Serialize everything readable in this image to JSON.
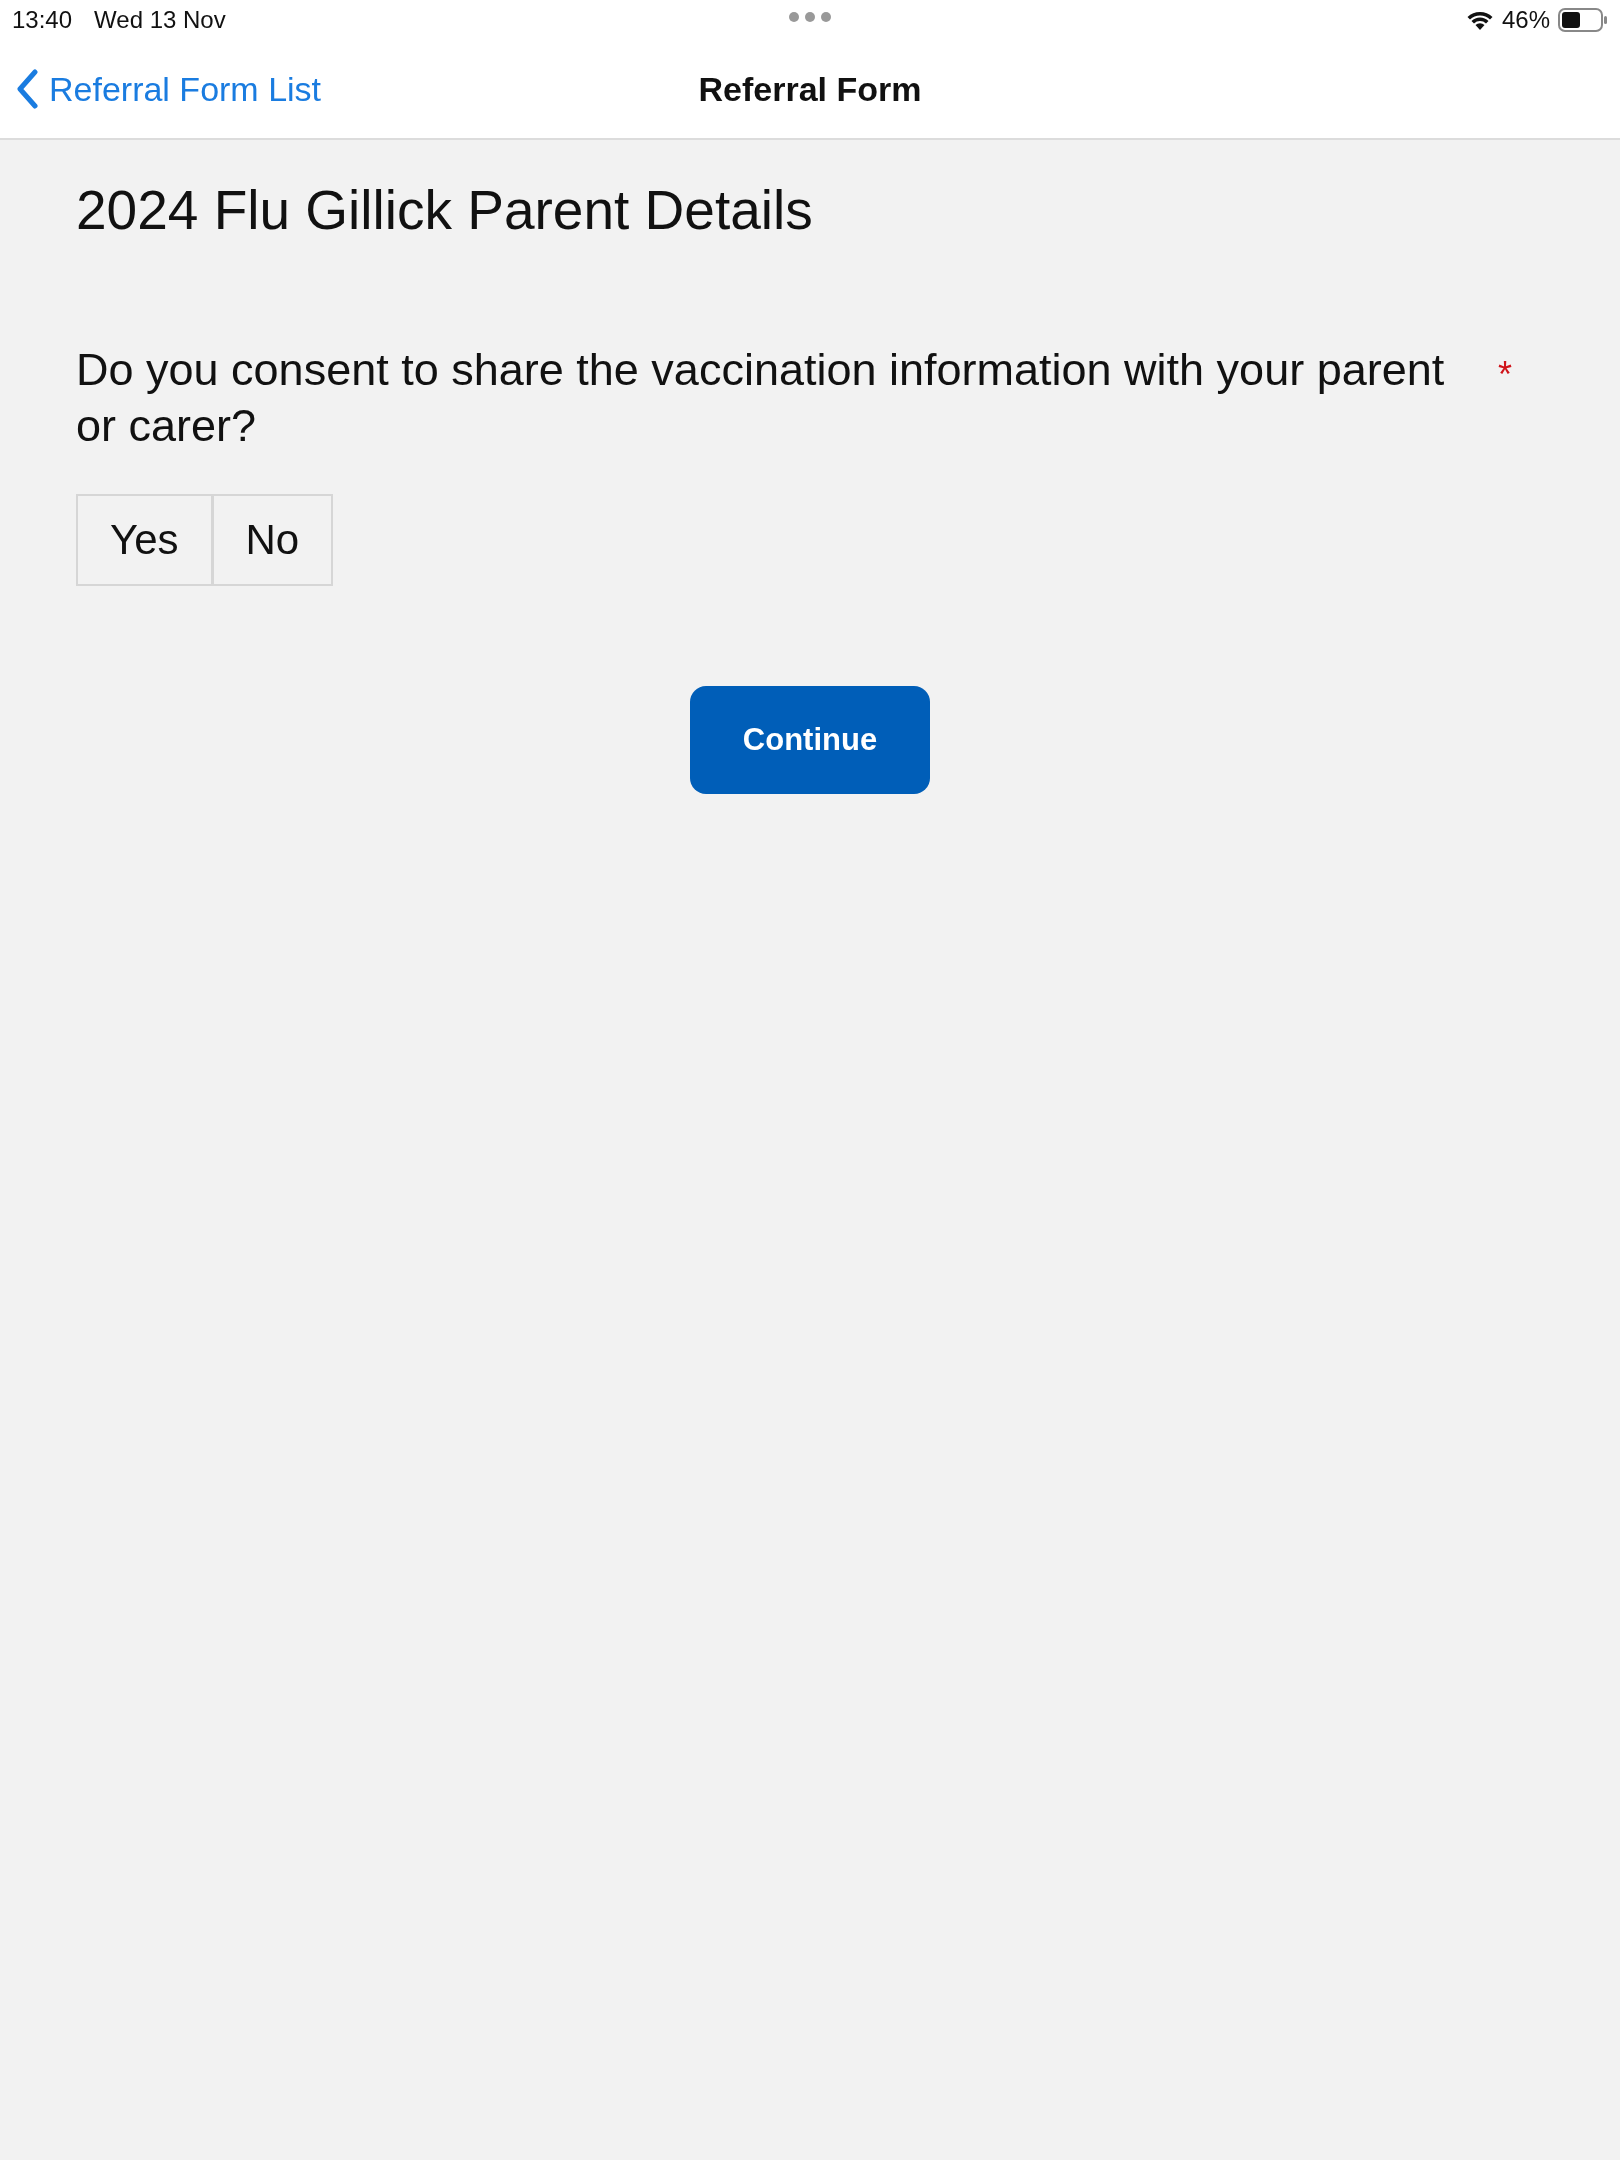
{
  "status_bar": {
    "time": "13:40",
    "date": "Wed 13 Nov",
    "battery": "46%"
  },
  "nav_bar": {
    "back": "Referral Form List",
    "title": "Referral Form"
  },
  "form": {
    "heading": "2024 Flu Gillick Parent Details",
    "question": {
      "text": "Do you consent to share the vaccination information with your parent or carer?",
      "required": true,
      "required_mark": "*",
      "options": [
        {
          "label": "Yes",
          "selected": false
        },
        {
          "label": "No",
          "selected": false
        }
      ]
    },
    "continue": "Continue"
  }
}
